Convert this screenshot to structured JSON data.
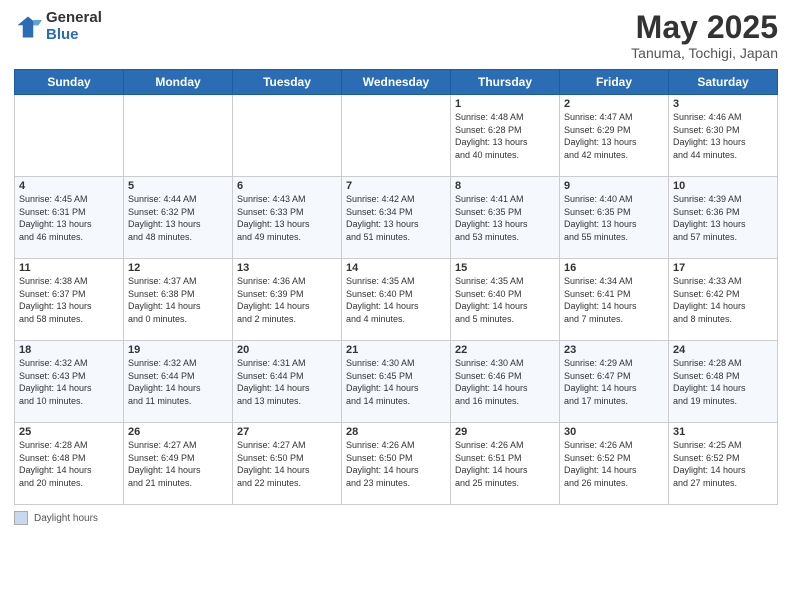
{
  "header": {
    "logo_general": "General",
    "logo_blue": "Blue",
    "title": "May 2025",
    "location": "Tanuma, Tochigi, Japan"
  },
  "weekdays": [
    "Sunday",
    "Monday",
    "Tuesday",
    "Wednesday",
    "Thursday",
    "Friday",
    "Saturday"
  ],
  "legend_label": "Daylight hours",
  "weeks": [
    [
      {
        "day": "",
        "info": ""
      },
      {
        "day": "",
        "info": ""
      },
      {
        "day": "",
        "info": ""
      },
      {
        "day": "",
        "info": ""
      },
      {
        "day": "1",
        "info": "Sunrise: 4:48 AM\nSunset: 6:28 PM\nDaylight: 13 hours\nand 40 minutes."
      },
      {
        "day": "2",
        "info": "Sunrise: 4:47 AM\nSunset: 6:29 PM\nDaylight: 13 hours\nand 42 minutes."
      },
      {
        "day": "3",
        "info": "Sunrise: 4:46 AM\nSunset: 6:30 PM\nDaylight: 13 hours\nand 44 minutes."
      }
    ],
    [
      {
        "day": "4",
        "info": "Sunrise: 4:45 AM\nSunset: 6:31 PM\nDaylight: 13 hours\nand 46 minutes."
      },
      {
        "day": "5",
        "info": "Sunrise: 4:44 AM\nSunset: 6:32 PM\nDaylight: 13 hours\nand 48 minutes."
      },
      {
        "day": "6",
        "info": "Sunrise: 4:43 AM\nSunset: 6:33 PM\nDaylight: 13 hours\nand 49 minutes."
      },
      {
        "day": "7",
        "info": "Sunrise: 4:42 AM\nSunset: 6:34 PM\nDaylight: 13 hours\nand 51 minutes."
      },
      {
        "day": "8",
        "info": "Sunrise: 4:41 AM\nSunset: 6:35 PM\nDaylight: 13 hours\nand 53 minutes."
      },
      {
        "day": "9",
        "info": "Sunrise: 4:40 AM\nSunset: 6:35 PM\nDaylight: 13 hours\nand 55 minutes."
      },
      {
        "day": "10",
        "info": "Sunrise: 4:39 AM\nSunset: 6:36 PM\nDaylight: 13 hours\nand 57 minutes."
      }
    ],
    [
      {
        "day": "11",
        "info": "Sunrise: 4:38 AM\nSunset: 6:37 PM\nDaylight: 13 hours\nand 58 minutes."
      },
      {
        "day": "12",
        "info": "Sunrise: 4:37 AM\nSunset: 6:38 PM\nDaylight: 14 hours\nand 0 minutes."
      },
      {
        "day": "13",
        "info": "Sunrise: 4:36 AM\nSunset: 6:39 PM\nDaylight: 14 hours\nand 2 minutes."
      },
      {
        "day": "14",
        "info": "Sunrise: 4:35 AM\nSunset: 6:40 PM\nDaylight: 14 hours\nand 4 minutes."
      },
      {
        "day": "15",
        "info": "Sunrise: 4:35 AM\nSunset: 6:40 PM\nDaylight: 14 hours\nand 5 minutes."
      },
      {
        "day": "16",
        "info": "Sunrise: 4:34 AM\nSunset: 6:41 PM\nDaylight: 14 hours\nand 7 minutes."
      },
      {
        "day": "17",
        "info": "Sunrise: 4:33 AM\nSunset: 6:42 PM\nDaylight: 14 hours\nand 8 minutes."
      }
    ],
    [
      {
        "day": "18",
        "info": "Sunrise: 4:32 AM\nSunset: 6:43 PM\nDaylight: 14 hours\nand 10 minutes."
      },
      {
        "day": "19",
        "info": "Sunrise: 4:32 AM\nSunset: 6:44 PM\nDaylight: 14 hours\nand 11 minutes."
      },
      {
        "day": "20",
        "info": "Sunrise: 4:31 AM\nSunset: 6:44 PM\nDaylight: 14 hours\nand 13 minutes."
      },
      {
        "day": "21",
        "info": "Sunrise: 4:30 AM\nSunset: 6:45 PM\nDaylight: 14 hours\nand 14 minutes."
      },
      {
        "day": "22",
        "info": "Sunrise: 4:30 AM\nSunset: 6:46 PM\nDaylight: 14 hours\nand 16 minutes."
      },
      {
        "day": "23",
        "info": "Sunrise: 4:29 AM\nSunset: 6:47 PM\nDaylight: 14 hours\nand 17 minutes."
      },
      {
        "day": "24",
        "info": "Sunrise: 4:28 AM\nSunset: 6:48 PM\nDaylight: 14 hours\nand 19 minutes."
      }
    ],
    [
      {
        "day": "25",
        "info": "Sunrise: 4:28 AM\nSunset: 6:48 PM\nDaylight: 14 hours\nand 20 minutes."
      },
      {
        "day": "26",
        "info": "Sunrise: 4:27 AM\nSunset: 6:49 PM\nDaylight: 14 hours\nand 21 minutes."
      },
      {
        "day": "27",
        "info": "Sunrise: 4:27 AM\nSunset: 6:50 PM\nDaylight: 14 hours\nand 22 minutes."
      },
      {
        "day": "28",
        "info": "Sunrise: 4:26 AM\nSunset: 6:50 PM\nDaylight: 14 hours\nand 23 minutes."
      },
      {
        "day": "29",
        "info": "Sunrise: 4:26 AM\nSunset: 6:51 PM\nDaylight: 14 hours\nand 25 minutes."
      },
      {
        "day": "30",
        "info": "Sunrise: 4:26 AM\nSunset: 6:52 PM\nDaylight: 14 hours\nand 26 minutes."
      },
      {
        "day": "31",
        "info": "Sunrise: 4:25 AM\nSunset: 6:52 PM\nDaylight: 14 hours\nand 27 minutes."
      }
    ]
  ]
}
